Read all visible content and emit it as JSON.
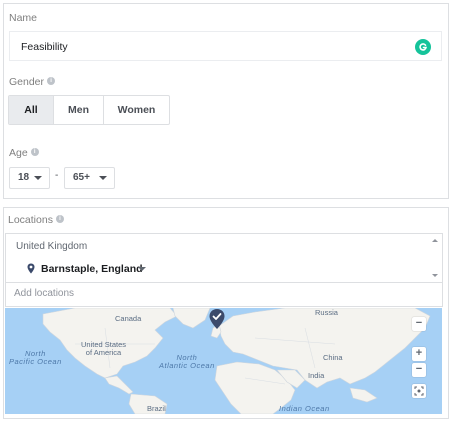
{
  "audience": {
    "name_label": "Name",
    "name_value": "Feasibility",
    "gender_label": "Gender",
    "gender_options": [
      "All",
      "Men",
      "Women"
    ],
    "gender_selected": "All",
    "age_label": "Age",
    "age_min": "18",
    "age_separator": "-",
    "age_max": "65+"
  },
  "locations": {
    "label": "Locations",
    "country": "United Kingdom",
    "location": "Barnstaple, England",
    "add_placeholder": "Add locations"
  },
  "map": {
    "labels": {
      "canada": "Canada",
      "usa": "United States\nof America",
      "north_pacific": "North\nPacific Ocean",
      "north_atlantic": "North\nAtlantic Ocean",
      "russia": "Russia",
      "china": "China",
      "india": "India",
      "brazil": "Brazil",
      "indian_ocean": "Indian Ocean"
    },
    "zoom_in": "+",
    "zoom_out": "−",
    "collapse": "−",
    "colors": {
      "water": "#a6d0f5",
      "land": "#f4f3ef",
      "pin": "#3b4a6b"
    }
  },
  "colors": {
    "grammarly": "#15c39a",
    "border": "#dddfe2",
    "selected_segment": "#e9ebee"
  },
  "icons": [
    "info-icon",
    "grammarly-icon",
    "location-pin-icon",
    "chevron-down-icon",
    "map-pin-icon",
    "recenter-icon"
  ]
}
